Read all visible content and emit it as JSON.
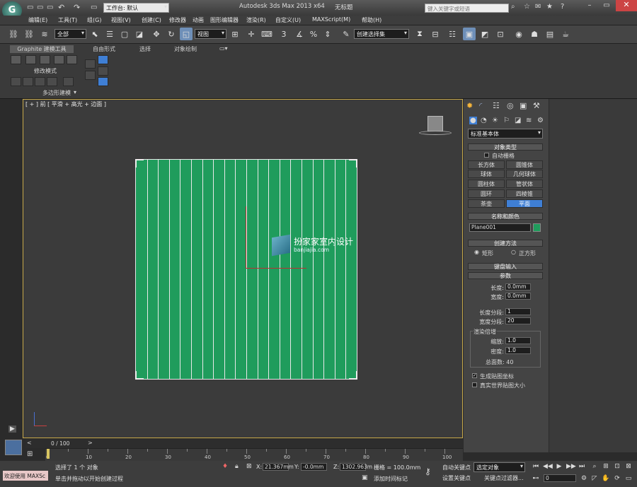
{
  "titlebar": {
    "workspace_label": "工作台: 默认",
    "app_title": "Autodesk 3ds Max  2013 x64",
    "doc_title": "无标题",
    "search_placeholder": "键入关键字或短语"
  },
  "menu": [
    "编辑(E)",
    "工具(T)",
    "组(G)",
    "视图(V)",
    "创建(C)",
    "修改器",
    "动画",
    "图形编辑器",
    "渲染(R)",
    "自定义(U)",
    "MAXScript(M)",
    "帮助(H)"
  ],
  "toolbar": {
    "selection_filter": "全部",
    "ref_coord": "视图",
    "named_selection": "创建选择集",
    "snap_2d": "3",
    "snap_angle": "%"
  },
  "ribbon": {
    "tabs": [
      "Graphite 建模工具",
      "自由形式",
      "选择",
      "对象绘制"
    ],
    "modify_mode": "修改模式",
    "polygon_modeling": "多边形建模"
  },
  "viewport": {
    "label": "[ + ] 前 [ 平滑 + 高光 + 边面 ]",
    "watermark_main": "扮家家室内设计",
    "watermark_sub": "banjiajia.com"
  },
  "cmdpanel": {
    "category": "标准基本体",
    "object_type_title": "对象类型",
    "autogrid": "自动栅格",
    "objects": [
      "长方体",
      "圆锥体",
      "球体",
      "几何球体",
      "圆柱体",
      "管状体",
      "圆环",
      "四棱锥",
      "茶壶",
      "平面"
    ],
    "selected_object": "平面",
    "name_color_title": "名称和颜色",
    "object_name": "Plane001",
    "object_color": "#1f9c5c",
    "creation_method_title": "创建方法",
    "method_rect": "矩形",
    "method_square": "正方形",
    "keyboard_entry": "键盘输入",
    "params_title": "参数",
    "length_label": "长度:",
    "length_value": "0.0mm",
    "width_label": "宽度:",
    "width_value": "0.0mm",
    "length_segs_label": "长度分段:",
    "length_segs_value": "1",
    "width_segs_label": "宽度分段:",
    "width_segs_value": "20",
    "render_mult_title": "渲染倍增",
    "scale_label": "缩放:",
    "scale_value": "1.0",
    "density_label": "密度:",
    "density_value": "1.0",
    "total_faces": "总面数: 40",
    "gen_mapping": "生成贴图坐标",
    "real_world": "真实世界贴图大小"
  },
  "timeline": {
    "position": "0 / 100",
    "ticks": [
      "0",
      "10",
      "20",
      "30",
      "40",
      "50",
      "60",
      "70",
      "80",
      "90",
      "100"
    ]
  },
  "status": {
    "welcome": "欢迎使用 MAXSc",
    "selected": "选择了 1 个 对象",
    "prompt": "单击并拖动以开始创建过程",
    "x_label": "X:",
    "x_value": "21.367mm",
    "y_label": "Y:",
    "y_value": "-0.0mm",
    "z_label": "Z:",
    "z_value": "1302.963m",
    "grid": "栅格 = 100.0mm",
    "add_time_tag": "添加时间标记",
    "auto_key": "自动关键点",
    "selected_obj": "选定对象",
    "set_key": "设置关键点",
    "key_filters": "关键点过滤器...",
    "frame": "0"
  }
}
